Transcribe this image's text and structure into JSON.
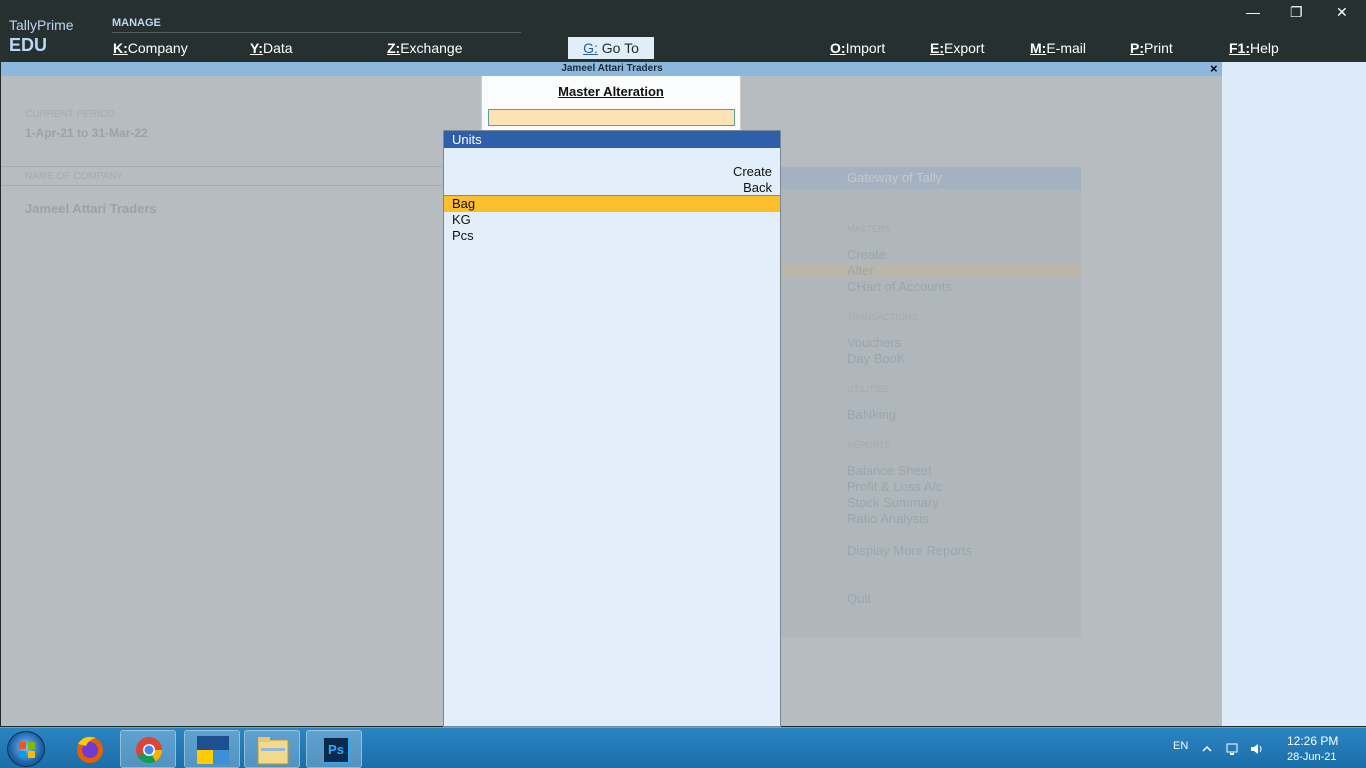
{
  "brand": {
    "line1": "TallyPrime",
    "line2": "EDU"
  },
  "menu_section": "MANAGE",
  "menu": [
    {
      "key": "K:",
      "label": "Company"
    },
    {
      "key": "Y:",
      "label": "Data"
    },
    {
      "key": "Z:",
      "label": "Exchange"
    }
  ],
  "goto": {
    "key": "G:",
    "label": "Go To"
  },
  "menu_right": [
    {
      "key": "O:",
      "label": "Import"
    },
    {
      "key": "E:",
      "label": "Export"
    },
    {
      "key": "M:",
      "label": "E-mail"
    },
    {
      "key": "P:",
      "label": "Print"
    },
    {
      "key": "F1:",
      "label": "Help"
    }
  ],
  "window_controls": {
    "minimize": "—",
    "restore": "❐",
    "close": "✕"
  },
  "company_bar": {
    "name": "Jameel Attari Traders",
    "close": "×"
  },
  "background": {
    "current_period_label": "CURRENT PERIOD",
    "current_period_value": "1-Apr-21 to 31-Mar-22",
    "name_label": "NAME OF COMPANY",
    "company_name": "Jameel Attari Traders"
  },
  "gateway": {
    "title": "Gateway of Tally",
    "sections": [
      {
        "heading": "MASTERS",
        "items": [
          "Create",
          "Alter",
          "CHart of Accounts"
        ]
      },
      {
        "heading": "TRANSACTIONS",
        "items": [
          "Vouchers",
          "Day BooK"
        ]
      },
      {
        "heading": "UTILITIES",
        "items": [
          "BaNking"
        ]
      },
      {
        "heading": "REPORTS",
        "items": [
          "Balance Sheet",
          "Profit & Loss A/c",
          "Stock Summary",
          "Ratio Analysis",
          "Display More Reports"
        ]
      }
    ],
    "quit": "Quit"
  },
  "master_alteration": {
    "title": "Master Alteration",
    "input_value": ""
  },
  "units": {
    "title": "Units",
    "actions": [
      "Create",
      "Back"
    ],
    "items": [
      "Bag",
      "KG",
      "Pcs"
    ],
    "selected": "Bag"
  },
  "taskbar": {
    "apps": [
      "firefox-icon",
      "chrome-icon",
      "tallyprime-icon",
      "file-explorer-icon",
      "photoshop-icon"
    ],
    "photoshop_label": "Ps",
    "lang": "EN",
    "time": "12:26 PM",
    "date": "28-Jun-21"
  }
}
